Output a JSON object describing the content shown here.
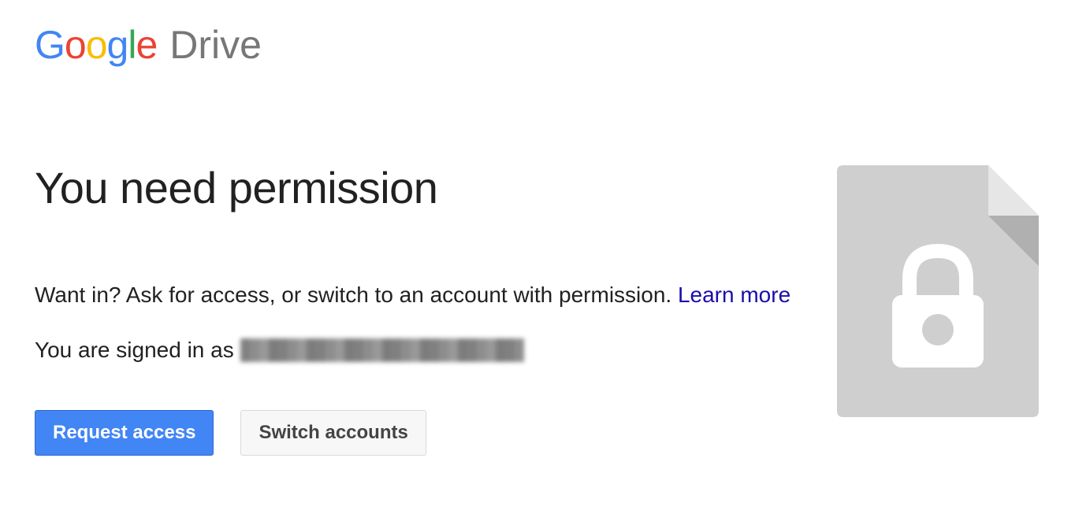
{
  "header": {
    "product": "Drive"
  },
  "main": {
    "title": "You need permission",
    "description_text": "Want in? Ask for access, or switch to an account with permission. ",
    "learn_more_label": "Learn more",
    "signed_in_prefix": "You are signed in as"
  },
  "buttons": {
    "request_access_label": "Request access",
    "switch_accounts_label": "Switch accounts"
  }
}
